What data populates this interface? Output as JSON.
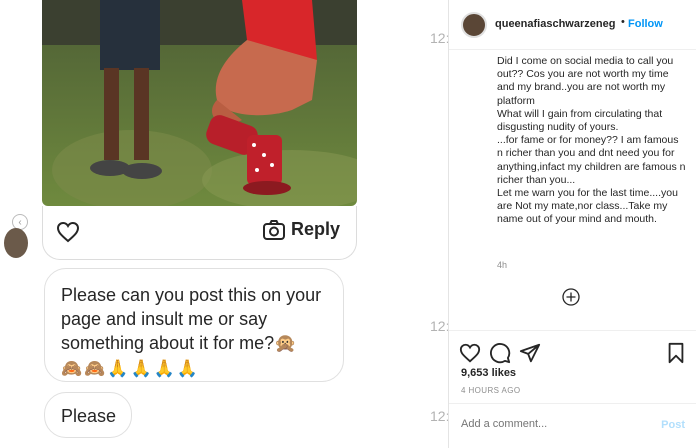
{
  "chat": {
    "reply_label": "Reply",
    "message_1": "Please can you post this on your page and insult me or say something about it for me?🙊",
    "message_1_emojis": "🙈🙈🙏🙏🙏🙏",
    "message_2": "Please",
    "time_stubs": [
      "12:",
      "12:",
      "12:"
    ]
  },
  "post": {
    "username": "queenafiaschwarzeneg",
    "dot": "•",
    "follow_label": "Follow",
    "caption": "Did I come on social media to call you out?? Cos you are not worth my time and my brand..you are not worth my platform\nWhat will I gain from circulating that disgusting nudity of yours.\n...for fame or for money?? I am famous n richer than you and dnt need you for anything,infact my children are famous n richer than you...\nLet me warn you for the last time....you are Not my mate,nor class...Take my name out of your mind and mouth.",
    "caption_time": "4h",
    "likes": "9,653 likes",
    "time_ago": "4 HOURS AGO",
    "comment_placeholder": "Add a comment...",
    "post_label": "Post"
  },
  "icons": {
    "heart": "heart-icon",
    "camera": "camera-icon",
    "comment": "comment-icon",
    "share": "share-icon",
    "bookmark": "bookmark-icon",
    "add": "plus-circle-icon"
  },
  "colors": {
    "link_blue": "#0095f6",
    "post_disabled": "#b2dffc",
    "meta_gray": "#8e8e8e"
  }
}
